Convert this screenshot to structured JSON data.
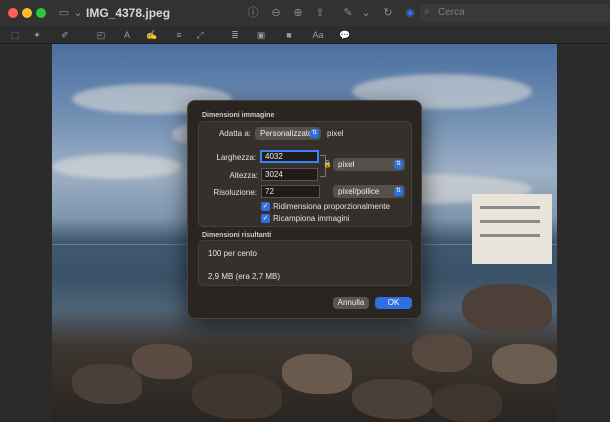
{
  "window": {
    "title": "IMG_4378.jpeg",
    "search_placeholder": "Cerca"
  },
  "dialog": {
    "section_size": "Dimensioni immagine",
    "fit_label": "Adatta a:",
    "fit_value": "Personalizzato",
    "fit_unit": "pixel",
    "width_label": "Larghezza:",
    "width_value": "4032",
    "height_label": "Altezza:",
    "height_value": "3024",
    "size_unit": "pixel",
    "resolution_label": "Risoluzione:",
    "resolution_value": "72",
    "resolution_unit": "pixel/pollice",
    "scale_proportionally": "Ridimensiona proporzionalmente",
    "scale_proportionally_checked": true,
    "resample": "Ricampiona immagini",
    "resample_checked": true,
    "section_result": "Dimensioni risultanti",
    "result_percent": "100 per cento",
    "result_size": "2,9 MB (era 2,7 MB)",
    "cancel_label": "Annulla",
    "ok_label": "OK"
  },
  "colors": {
    "accent": "#2f6fe0",
    "dialog_bg": "#2b2522"
  }
}
